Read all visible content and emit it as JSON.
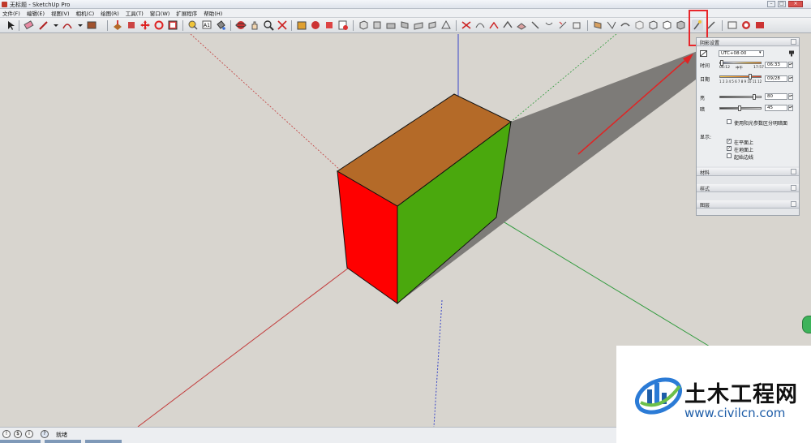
{
  "window": {
    "title": "无标题 - SketchUp Pro",
    "controls": [
      "–",
      "□",
      "×"
    ]
  },
  "menu": {
    "items": [
      "文件(F)",
      "编辑(E)",
      "视图(V)",
      "相机(C)",
      "绘图(R)",
      "工具(T)",
      "窗口(W)",
      "扩展程序",
      "帮助(H)"
    ]
  },
  "toolbar": {
    "highlighted_tool": "shadows-tool",
    "highlight_color": "#e8262b"
  },
  "scene": {
    "colors": {
      "box_top": "#b46a28",
      "box_left": "#ff0000",
      "box_right": "#4aa80d",
      "shadow": "#7d7b78",
      "axis_red": "#c23b3b",
      "axis_green": "#2f9a3c",
      "axis_blue": "#3a48c8",
      "arrow": "#e02424"
    }
  },
  "shadow_panel": {
    "title": "阴影设置",
    "timezone": "UTC+08:00",
    "time_label": "时间",
    "time_start": "06:12",
    "time_noon": "中午",
    "time_end": "17:57",
    "time_value": "06:33",
    "date_label": "日期",
    "months": "1 2 3 4 5 6 7 8 9 10 11 12",
    "date_value": "09/28",
    "light_label": "亮",
    "light_value": "80",
    "dark_label": "暗",
    "dark_value": "45",
    "use_sun_label": "使用阳光参数区分明暗面",
    "display_label": "显示:",
    "on_faces_label": "在平面上",
    "on_ground_label": "在地面上",
    "from_edges_label": "起始边线"
  },
  "collapsed_panels": [
    "材料",
    "样式",
    "图层"
  ],
  "status": {
    "text": "就绪"
  },
  "watermark": {
    "name": "土木工程网",
    "url": "www.civilcn.com"
  }
}
